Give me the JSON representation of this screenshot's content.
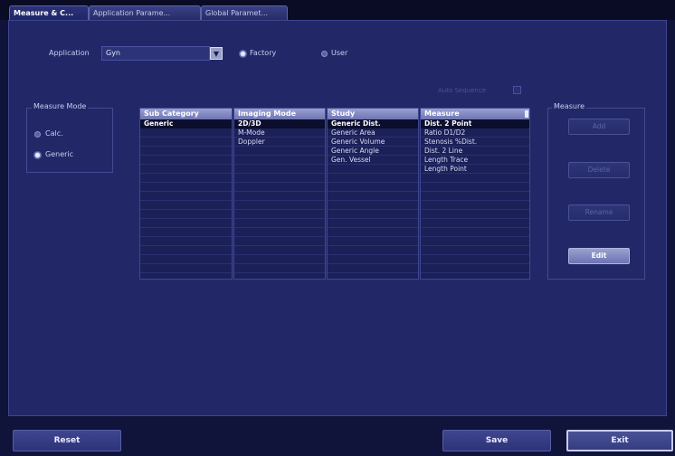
{
  "tabs": [
    {
      "label": "Measure & C...",
      "active": true
    },
    {
      "label": "Application Parame...",
      "active": false
    },
    {
      "label": "Global Paramet...",
      "active": false
    }
  ],
  "application": {
    "label": "Application",
    "value": "Gyn",
    "options": [
      {
        "label": "Factory",
        "selected": true
      },
      {
        "label": "User",
        "selected": false
      }
    ]
  },
  "measure_mode": {
    "title": "Measure Mode",
    "options": [
      {
        "label": "Calc.",
        "selected": false
      },
      {
        "label": "Generic",
        "selected": true
      }
    ]
  },
  "context_checkbox_label": "Auto Sequence",
  "columns": [
    {
      "header": "Sub Category",
      "items": [
        "Generic"
      ],
      "selected_index": 0
    },
    {
      "header": "Imaging Mode",
      "items": [
        "2D/3D",
        "M-Mode",
        "Doppler"
      ],
      "selected_index": 0
    },
    {
      "header": "Study",
      "items": [
        "Generic Dist.",
        "Generic Area",
        "Generic Volume",
        "Generic Angle",
        "Gen. Vessel"
      ],
      "selected_index": 0
    },
    {
      "header": "Measure",
      "items": [
        "Dist. 2 Point",
        "Ratio D1/D2",
        "Stenosis %Dist.",
        "Dist. 2 Line",
        "Length Trace",
        "Length Point"
      ],
      "selected_index": 0
    }
  ],
  "measure_group": {
    "title": "Measure",
    "buttons": [
      {
        "label": "Add",
        "enabled": false
      },
      {
        "label": "Delete",
        "enabled": false
      },
      {
        "label": "Rename",
        "enabled": false
      },
      {
        "label": "Edit",
        "enabled": true
      }
    ]
  },
  "footer": {
    "reset": "Reset",
    "save": "Save",
    "exit": "Exit"
  }
}
